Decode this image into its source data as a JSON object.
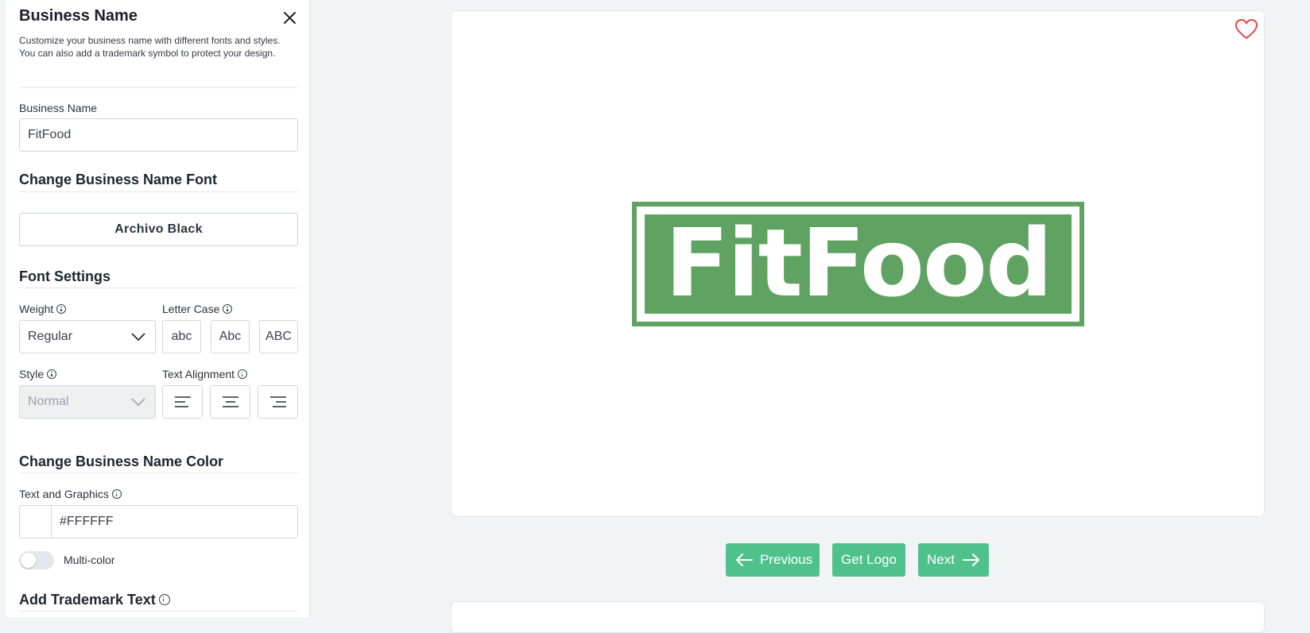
{
  "panel": {
    "title": "Business Name",
    "description": "Customize your business name with different fonts and styles. You can also add a trademark symbol to protect your design.",
    "business_name_label": "Business Name",
    "business_name_value": "FitFood",
    "change_font_title": "Change Business Name Font",
    "current_font": "Archivo Black",
    "font_settings_title": "Font Settings",
    "weight_label": "Weight",
    "weight_value": "Regular",
    "letter_case_label": "Letter Case",
    "letter_case_options": [
      "abc",
      "Abc",
      "ABC"
    ],
    "style_label": "Style",
    "style_value": "Normal",
    "text_alignment_label": "Text Alignment",
    "change_color_title": "Change Business Name Color",
    "text_graphics_label": "Text and Graphics",
    "color_value": "#FFFFFF",
    "multicolor_label": "Multi-color",
    "trademark_title": "Add Trademark Text"
  },
  "canvas": {
    "logo_text": "FitFood",
    "logo_color": "#5fa262",
    "favorite_icon": "heart-icon"
  },
  "nav": {
    "previous_label": "Previous",
    "get_logo_label": "Get Logo",
    "next_label": "Next",
    "button_color": "#4fc28c"
  }
}
